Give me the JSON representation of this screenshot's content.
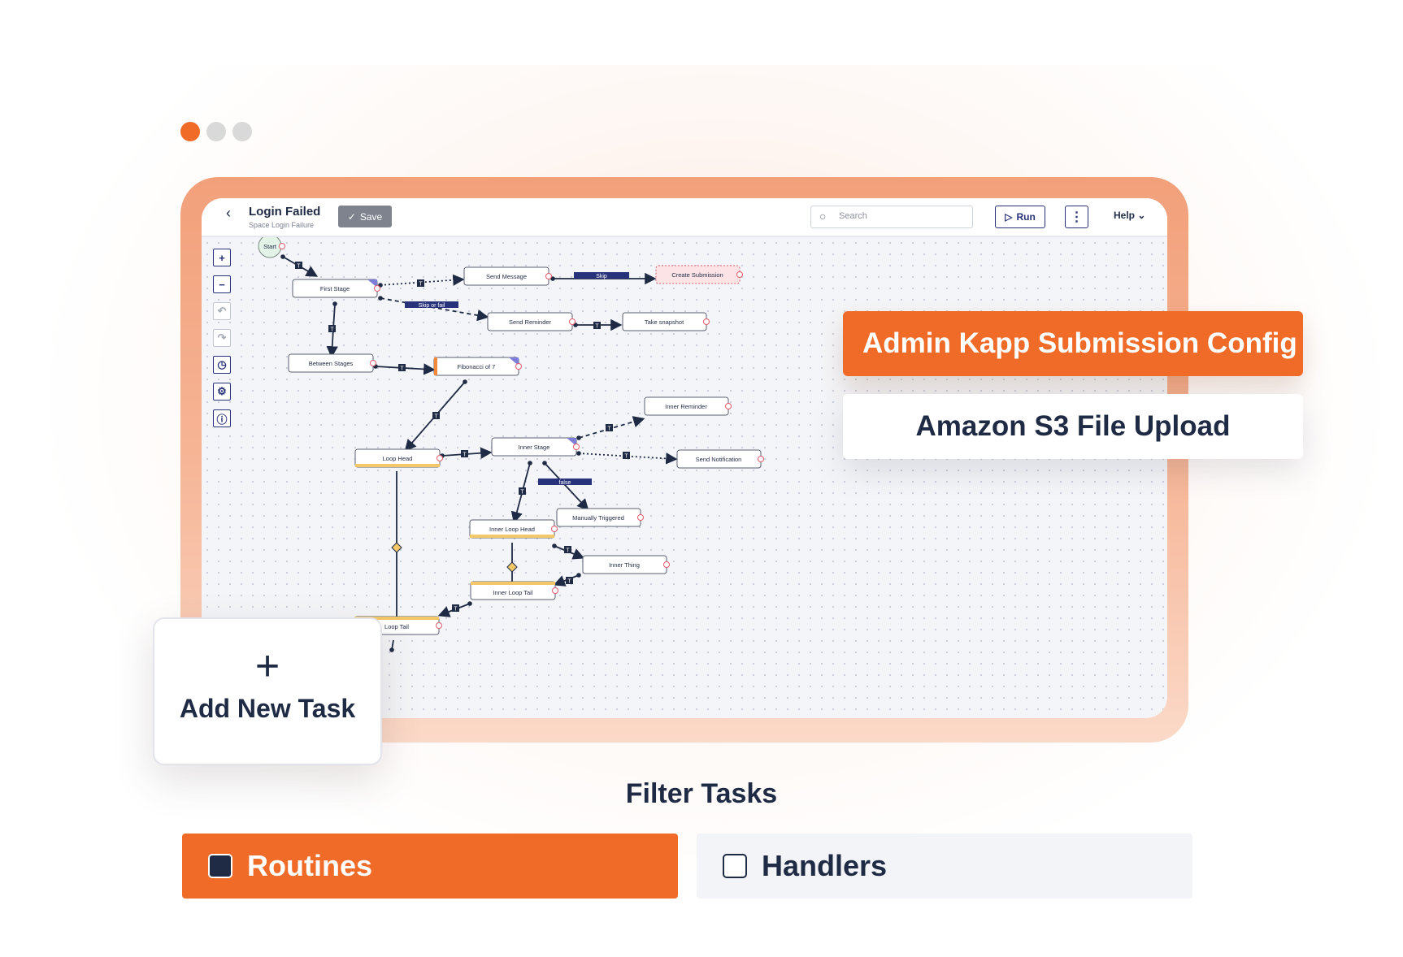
{
  "window_controls": [
    "close",
    "minimize",
    "maximize"
  ],
  "editor": {
    "title": "Login Failed",
    "subtitle": "Space Login Failure",
    "save_label": "Save",
    "search_placeholder": "Search",
    "run_label": "Run",
    "more_label": "⋮",
    "help_label": "Help"
  },
  "toolbar": [
    "zoom-in",
    "zoom-out",
    "undo",
    "redo",
    "history",
    "settings",
    "info"
  ],
  "workflow": {
    "nodes": [
      {
        "id": "start",
        "label": "Start"
      },
      {
        "id": "first",
        "label": "First Stage"
      },
      {
        "id": "sendmsg",
        "label": "Send Message"
      },
      {
        "id": "createsub",
        "label": "Create Submission"
      },
      {
        "id": "sendrem",
        "label": "Send Reminder"
      },
      {
        "id": "snapshot",
        "label": "Take snapshot"
      },
      {
        "id": "between",
        "label": "Between Stages"
      },
      {
        "id": "fib",
        "label": "Fibonacci of 7"
      },
      {
        "id": "innerrem",
        "label": "Inner Reminder"
      },
      {
        "id": "loophead",
        "label": "Loop Head"
      },
      {
        "id": "innerstage",
        "label": "Inner Stage"
      },
      {
        "id": "sendnotif",
        "label": "Send Notification"
      },
      {
        "id": "manual",
        "label": "Manually Triggered"
      },
      {
        "id": "innerloophead",
        "label": "Inner Loop Head"
      },
      {
        "id": "innerthing",
        "label": "Inner Thing"
      },
      {
        "id": "innerlooptail",
        "label": "Inner Loop Tail"
      },
      {
        "id": "looptail",
        "label": "Loop Tail"
      }
    ],
    "connector_labels": [
      "Skip",
      "Skip or fail",
      "false"
    ],
    "badge": "T"
  },
  "panels": {
    "selected": "Admin Kapp Submission Config",
    "option": "Amazon S3 File Upload"
  },
  "add_task": {
    "plus": "+",
    "label": "Add New Task"
  },
  "filter": {
    "title": "Filter Tasks",
    "routines_label": "Routines",
    "handlers_label": "Handlers"
  },
  "colors": {
    "accent": "#f06a28",
    "navy": "#1f2a44",
    "link": "#27327a"
  }
}
